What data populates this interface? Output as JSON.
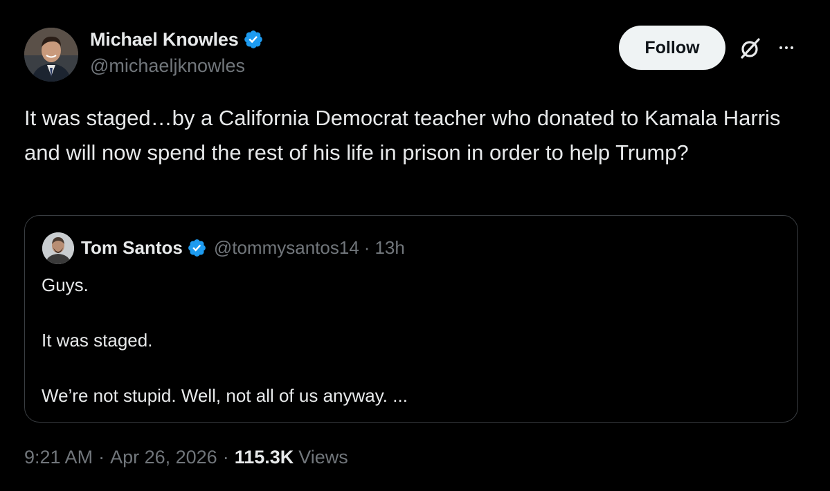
{
  "tweet": {
    "author": {
      "name": "Michael Knowles",
      "handle": "@michaeljknowles",
      "verified": true
    },
    "follow_label": "Follow",
    "text": "It was staged…by a California Democrat teacher who donated to Kamala Harris and will now spend the rest of his life in prison in order to help Trump?",
    "quoted": {
      "author_name": "Tom Santos",
      "handle": "@tommysantos14",
      "separator": "·",
      "time": "13h",
      "verified": true,
      "paragraphs": [
        "Guys.",
        "It was staged.",
        "We’re not stupid. Well, not all of us anyway. ..."
      ]
    },
    "meta": {
      "time": "9:21 AM",
      "separator": "·",
      "date": "Apr 26, 2026",
      "views_count": "115.3K",
      "views_label": "Views"
    }
  },
  "icons": {
    "verified": "verified-badge-icon",
    "grok": "grok-icon",
    "more": "more-options-icon"
  },
  "colors": {
    "background": "#000000",
    "primary_text": "#e7e9ea",
    "secondary_text": "#71767b",
    "verified_blue": "#1d9bf0",
    "follow_button_bg": "#eff3f4",
    "follow_button_text": "#0f1419",
    "card_border": "#3a3e42"
  }
}
